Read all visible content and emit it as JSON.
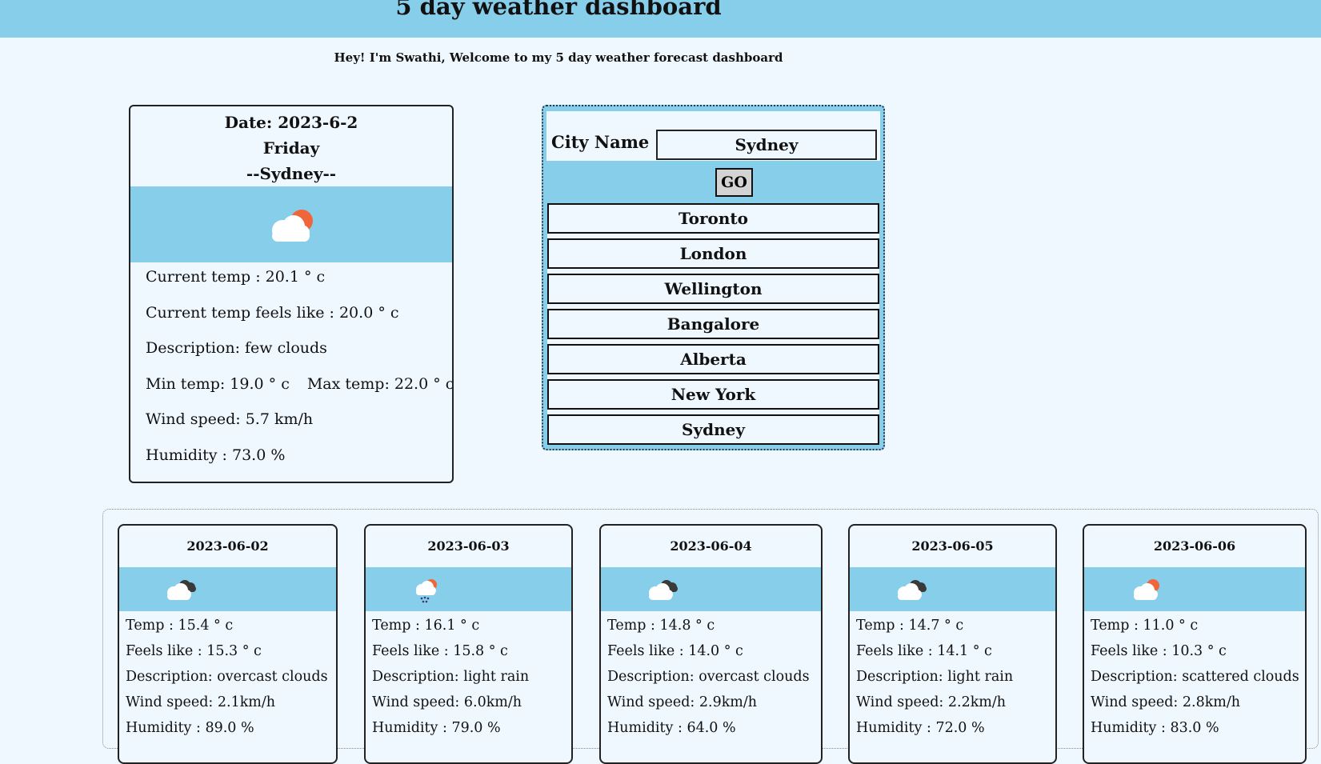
{
  "header": {
    "title": "5 day weather dashboard",
    "subtitle": "Hey! I'm Swathi, Welcome to my 5 day weather forecast dashboard",
    "bar_color": "#87ceeb"
  },
  "current": {
    "date": "Date: 2023-6-2",
    "day": "Friday",
    "city": "--Sydney--",
    "icon": "few-clouds-day-icon",
    "current_temp": "Current temp : 20.1 ° c",
    "feels_like": "Current temp feels like : 20.0 ° c",
    "description": "Description: few clouds",
    "min_temp": "Min temp: 19.0 ° c",
    "max_temp": "Max temp: 22.0 ° c",
    "wind": "Wind speed: 5.7 km/h",
    "humidity": "Humidity : 73.0 %"
  },
  "search": {
    "label": "City Name :",
    "value": "Sydney",
    "go_label": "GO",
    "cities": [
      "Toronto",
      "London",
      "Wellington",
      "Bangalore",
      "Alberta",
      "New York",
      "Sydney"
    ]
  },
  "forecast": [
    {
      "date": "2023-06-02",
      "icon": "overcast-clouds-icon",
      "temp": "Temp : 15.4 ° c",
      "feels": "Feels like : 15.3 ° c",
      "desc": "Description: overcast clouds",
      "wind": "Wind speed: 2.1km/h",
      "humidity": "Humidity : 89.0 %"
    },
    {
      "date": "2023-06-03",
      "icon": "light-rain-icon",
      "temp": "Temp : 16.1 ° c",
      "feels": "Feels like : 15.8 ° c",
      "desc": "Description: light rain",
      "wind": "Wind speed: 6.0km/h",
      "humidity": "Humidity : 79.0 %"
    },
    {
      "date": "2023-06-04",
      "icon": "overcast-clouds-icon",
      "temp": "Temp : 14.8 ° c",
      "feels": "Feels like : 14.0 ° c",
      "desc": "Description: overcast clouds",
      "wind": "Wind speed: 2.9km/h",
      "humidity": "Humidity : 64.0 %"
    },
    {
      "date": "2023-06-05",
      "icon": "overcast-clouds-icon",
      "temp": "Temp : 14.7 ° c",
      "feels": "Feels like : 14.1 ° c",
      "desc": "Description: light rain",
      "wind": "Wind speed: 2.2km/h",
      "humidity": "Humidity : 72.0 %"
    },
    {
      "date": "2023-06-06",
      "icon": "scattered-clouds-day-icon",
      "temp": "Temp : 11.0 ° c",
      "feels": "Feels like : 10.3 ° c",
      "desc": "Description: scattered clouds",
      "wind": "Wind speed: 2.8km/h",
      "humidity": "Humidity : 83.0 %"
    }
  ]
}
